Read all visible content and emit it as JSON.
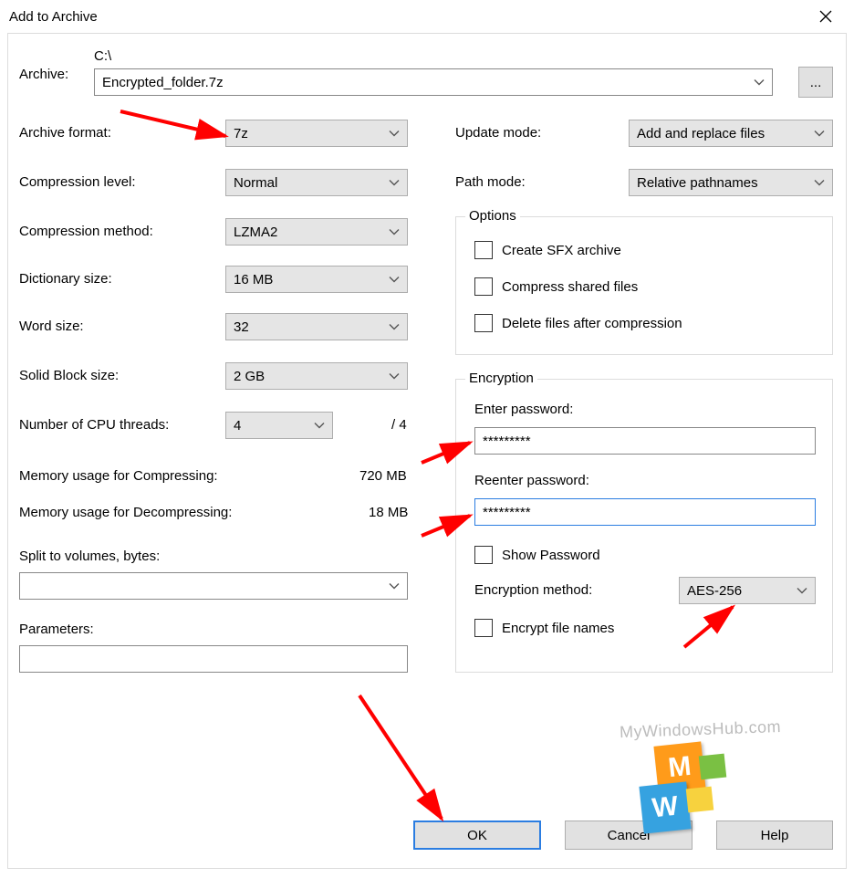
{
  "title": "Add to Archive",
  "archive_path_label": "C:\\",
  "archive_label": "Archive:",
  "archive_filename": "Encrypted_folder.7z",
  "browse_btn": "...",
  "left": {
    "format_label": "Archive format:",
    "format_value": "7z",
    "level_label": "Compression level:",
    "level_value": "Normal",
    "method_label": "Compression method:",
    "method_value": "LZMA2",
    "dict_label": "Dictionary size:",
    "dict_value": "16 MB",
    "word_label": "Word size:",
    "word_value": "32",
    "solid_label": "Solid Block size:",
    "solid_value": "2 GB",
    "cpu_label": "Number of CPU threads:",
    "cpu_value": "4",
    "cpu_total": "/ 4",
    "mem_comp_label": "Memory usage for Compressing:",
    "mem_comp_value": "720 MB",
    "mem_decomp_label": "Memory usage for Decompressing:",
    "mem_decomp_value": "18 MB",
    "split_label": "Split to volumes, bytes:",
    "split_value": "",
    "params_label": "Parameters:",
    "params_value": ""
  },
  "right": {
    "update_label": "Update mode:",
    "update_value": "Add and replace files",
    "path_label": "Path mode:",
    "path_value": "Relative pathnames",
    "options_legend": "Options",
    "opt_sfx": "Create SFX archive",
    "opt_shared": "Compress shared files",
    "opt_delete": "Delete files after compression",
    "enc_legend": "Encryption",
    "enc_enter": "Enter password:",
    "enc_pwd1": "*********",
    "enc_reenter": "Reenter password:",
    "enc_pwd2": "*********",
    "enc_show": "Show Password",
    "enc_method_label": "Encryption method:",
    "enc_method_value": "AES-256",
    "enc_names": "Encrypt file names"
  },
  "buttons": {
    "ok": "OK",
    "cancel": "Cancel",
    "help": "Help"
  },
  "watermark": "MyWindowsHub.com"
}
